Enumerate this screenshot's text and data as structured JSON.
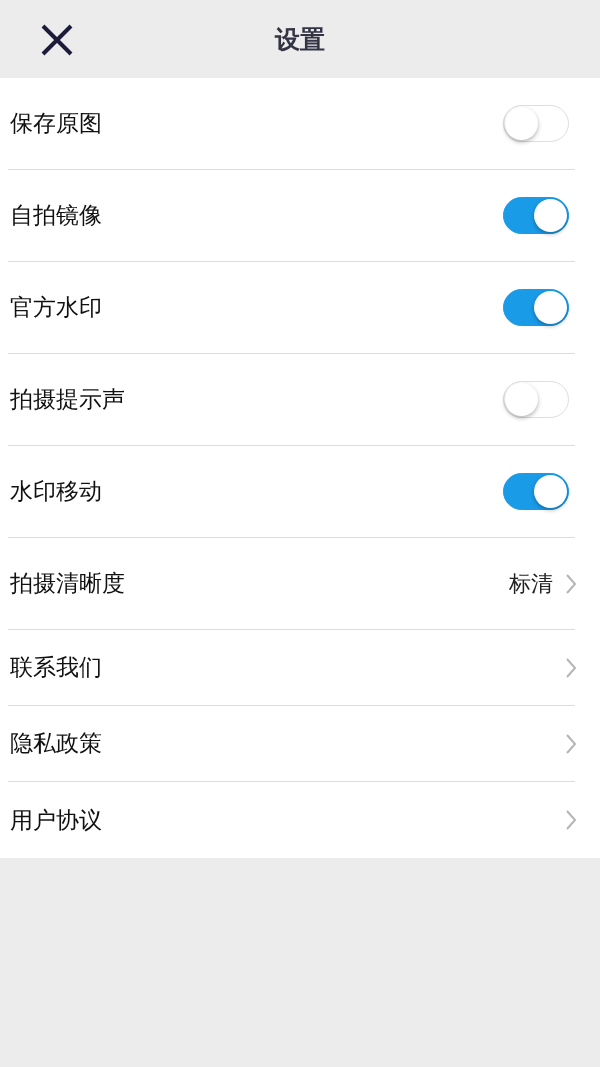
{
  "header": {
    "title": "设置"
  },
  "rows": [
    {
      "kind": "toggle",
      "label": "保存原图",
      "on": false
    },
    {
      "kind": "toggle",
      "label": "自拍镜像",
      "on": true
    },
    {
      "kind": "toggle",
      "label": "官方水印",
      "on": true
    },
    {
      "kind": "toggle",
      "label": "拍摄提示声",
      "on": false
    },
    {
      "kind": "toggle",
      "label": "水印移动",
      "on": true
    },
    {
      "kind": "value",
      "label": "拍摄清晰度",
      "value": "标清"
    },
    {
      "kind": "link",
      "label": "联系我们"
    },
    {
      "kind": "link",
      "label": "隐私政策"
    },
    {
      "kind": "link",
      "label": "用户协议"
    }
  ]
}
